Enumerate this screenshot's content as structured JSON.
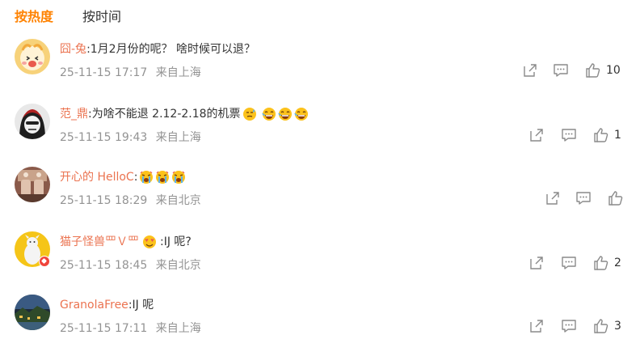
{
  "tabs": [
    {
      "label": "按热度",
      "active": true
    },
    {
      "label": "按时间",
      "active": false
    }
  ],
  "comments": [
    {
      "username": "囧-兔",
      "text": ":1月2月份的呢？  啥时候可以退？",
      "time": "25-11-15 17:17",
      "location": "来自上海",
      "likes": "10",
      "emojis": []
    },
    {
      "username": "范_鼎",
      "text": ":为啥不能退 2.12-2.18的机票",
      "time": "25-11-15 19:43",
      "location": "来自上海",
      "likes": "1",
      "emojis": [
        "sweat-emoji",
        "laugh-emoji",
        "laugh-emoji",
        "laugh-emoji"
      ]
    },
    {
      "username": "开心的 HelloC",
      "text": ":",
      "time": "25-11-15 18:29",
      "location": "来自北京",
      "likes": "",
      "emojis": [
        "crying-emoji",
        "crying-emoji",
        "crying-emoji"
      ]
    },
    {
      "username": "猫子怪兽罒Ｖ罒",
      "text": ":IJ 呢?",
      "time": "25-11-15 18:45",
      "location": "来自北京",
      "likes": "2",
      "emojis": [
        "heart-eyes-emoji"
      ]
    },
    {
      "username": "GranolaFree",
      "text": ":IJ 呢",
      "time": "25-11-15 17:11",
      "location": "来自上海",
      "likes": "3",
      "emojis": []
    }
  ],
  "colors": {
    "accent": "#ff8200",
    "username": "#eb7350",
    "meta": "#939393",
    "icon": "#8a8a8a"
  }
}
